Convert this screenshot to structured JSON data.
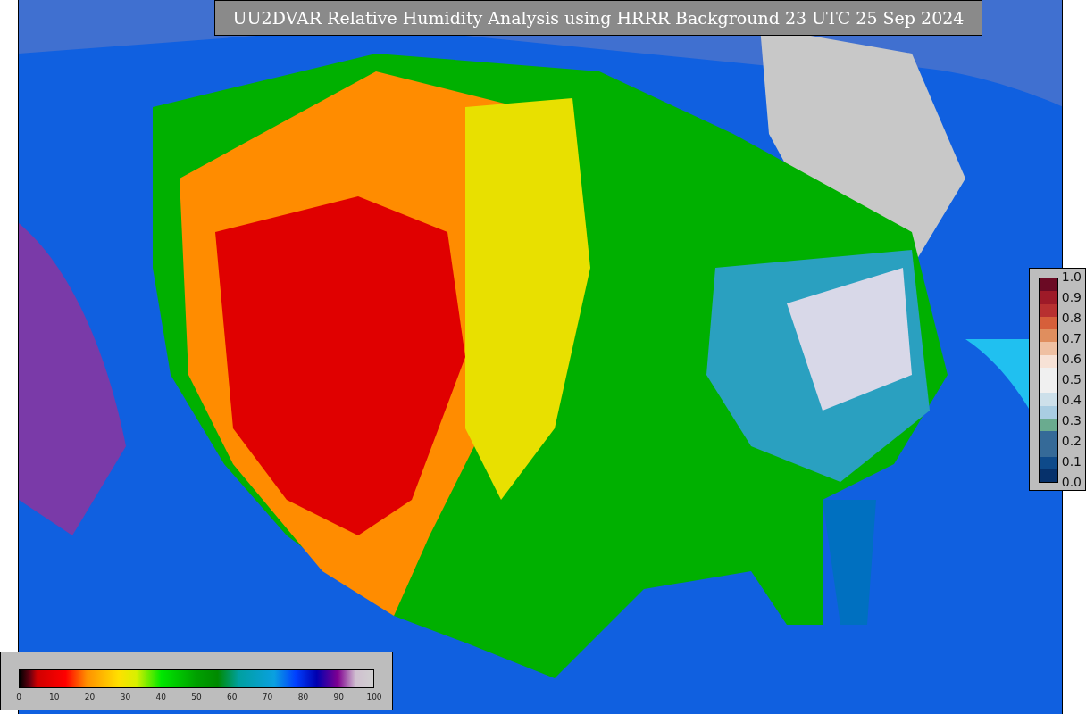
{
  "title": "UU2DVAR Relative Humidity Analysis using HRRR Background 23 UTC 25 Sep 2024",
  "right_colorbar": {
    "ticks": [
      "1.0",
      "0.9",
      "0.8",
      "0.7",
      "0.6",
      "0.5",
      "0.4",
      "0.3",
      "0.2",
      "0.1",
      "0.0"
    ],
    "segments": [
      {
        "color": "#6b0a24"
      },
      {
        "color": "#9e1a28"
      },
      {
        "color": "#b83030"
      },
      {
        "color": "#d65f3a"
      },
      {
        "color": "#e08e5e"
      },
      {
        "color": "#efc0a2"
      },
      {
        "color": "#f7e2d6"
      },
      {
        "color": "#f0f0f0"
      },
      {
        "color": "#f0f0f0"
      },
      {
        "color": "#cde0ea"
      },
      {
        "color": "#a9cde2"
      },
      {
        "color": "#6aab8f"
      },
      {
        "color": "#356a98"
      },
      {
        "color": "#356a98"
      },
      {
        "color": "#0e4a8a"
      },
      {
        "color": "#06316b"
      }
    ]
  },
  "bottom_colorbar": {
    "ticks": [
      "0",
      "10",
      "20",
      "30",
      "40",
      "50",
      "60",
      "70",
      "80",
      "90",
      "100"
    ]
  }
}
